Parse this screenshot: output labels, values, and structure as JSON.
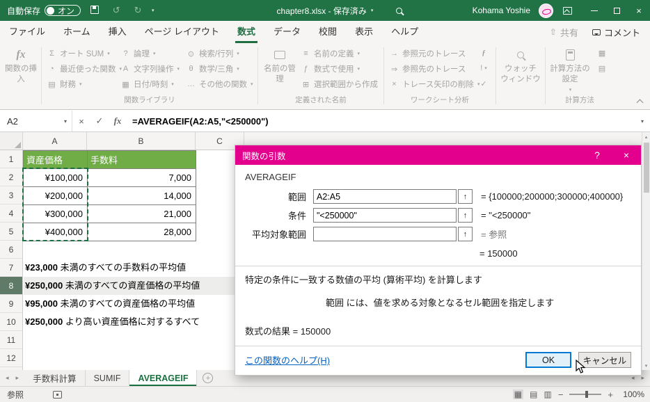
{
  "colors": {
    "titlebar_green": "#217346",
    "dialog_title_pink": "#E3008C",
    "table_header_green": "#70AD47",
    "link_blue": "#0563C1"
  },
  "icons": {
    "sigma": "Σ",
    "clock": "◔",
    "financial": "▤",
    "logical": "?",
    "text_fn": "A",
    "calendar": "▦",
    "lookup": "⊙",
    "theta": "θ",
    "ellipsis": "…",
    "list": "≡",
    "fn_italic": "ƒ",
    "grid_plus": "⊞",
    "arrow_right": "→",
    "arrow_double": "⇒",
    "cross": "×",
    "warning": "!",
    "check": "✓",
    "undo": "↺",
    "redo": "↻",
    "caret_down": "▾",
    "caret_up": "▴",
    "tri_left": "◂",
    "tri_right": "▸",
    "close": "×",
    "fx": "fx",
    "up_arrow": "↑",
    "question": "?",
    "view_normal": "▦",
    "view_layout": "▤",
    "view_break": "▥",
    "minus": "−",
    "plus": "+"
  },
  "titlebar": {
    "autosave_label": "自動保存",
    "autosave_state": "オン",
    "document_title": "chapter8.xlsx - 保存済み",
    "user_name": "Kohama Yoshie"
  },
  "ribbon_tabs": [
    {
      "label": "ファイル"
    },
    {
      "label": "ホーム"
    },
    {
      "label": "挿入"
    },
    {
      "label": "ページ レイアウト"
    },
    {
      "label": "数式"
    },
    {
      "label": "データ"
    },
    {
      "label": "校閲"
    },
    {
      "label": "表示"
    },
    {
      "label": "ヘルプ"
    }
  ],
  "ribbon_right": {
    "share": "共有",
    "comments": "コメント"
  },
  "ribbon": {
    "insert_function": "関数の挿入",
    "library": {
      "label": "関数ライブラリ",
      "autosum": "オート SUM",
      "recent": "最近使った関数",
      "financial": "財務",
      "logical": "論理",
      "text": "文字列操作",
      "datetime": "日付/時刻",
      "lookup": "検索/行列",
      "math": "数学/三角",
      "more": "その他の関数"
    },
    "names": {
      "label": "定義された名前",
      "manager": "名前の管理",
      "define": "名前の定義",
      "use": "数式で使用",
      "create": "選択範囲から作成"
    },
    "auditing": {
      "label": "ワークシート分析",
      "precedents": "参照元のトレース",
      "dependents": "参照先のトレース",
      "remove": "トレース矢印の削除"
    },
    "watch": "ウォッチ ウィンドウ",
    "calc": {
      "label": "計算方法",
      "options": "計算方法の設定"
    }
  },
  "formula_bar": {
    "name_box": "A2",
    "formula": "=AVERAGEIF(A2:A5,\"<250000\")"
  },
  "grid": {
    "col_headers": [
      "A",
      "B",
      "C"
    ],
    "row_numbers": [
      "1",
      "2",
      "3",
      "4",
      "5",
      "6",
      "7",
      "8",
      "9",
      "10",
      "11",
      "12"
    ],
    "table": {
      "headers": {
        "a": "資産価格",
        "b": "手数料"
      },
      "rows": [
        {
          "a": "¥100,000",
          "b": "7,000"
        },
        {
          "a": "¥200,000",
          "b": "14,000"
        },
        {
          "a": "¥300,000",
          "b": "21,000"
        },
        {
          "a": "¥400,000",
          "b": "28,000"
        }
      ]
    },
    "notes": [
      {
        "amount": "¥23,000",
        "text": " 未満のすべての手数料の平均値"
      },
      {
        "amount": "¥250,000",
        "text": " 未満のすべての資産価格の平均値"
      },
      {
        "amount": "¥95,000",
        "text": " 未満のすべての資産価格の平均値"
      },
      {
        "amount": "¥250,000",
        "text": " より高い資産価格に対するすべて"
      }
    ]
  },
  "dialog": {
    "title": "関数の引数",
    "function_name": "AVERAGEIF",
    "fields": [
      {
        "label": "範囲",
        "value": "A2:A5",
        "result": "=  {100000;200000;300000;400000}"
      },
      {
        "label": "条件",
        "value": "\"<250000\"",
        "result": "=  \"<250000\""
      },
      {
        "label": "平均対象範囲",
        "value": "",
        "result": "=  参照"
      }
    ],
    "interim_result": "=  150000",
    "description": "特定の条件に一致する数値の平均 (算術平均) を計算します",
    "argument_help": "範囲  には、値を求める対象となるセル範囲を指定します",
    "formula_result": "数式の結果 =  150000",
    "help_link": "この関数のヘルプ(H)",
    "ok": "OK",
    "cancel": "キャンセル"
  },
  "sheet_tabs": [
    {
      "label": "手数料計算"
    },
    {
      "label": "SUMIF"
    },
    {
      "label": "AVERAGEIF"
    }
  ],
  "status_bar": {
    "mode": "参照",
    "zoom": "100%"
  }
}
